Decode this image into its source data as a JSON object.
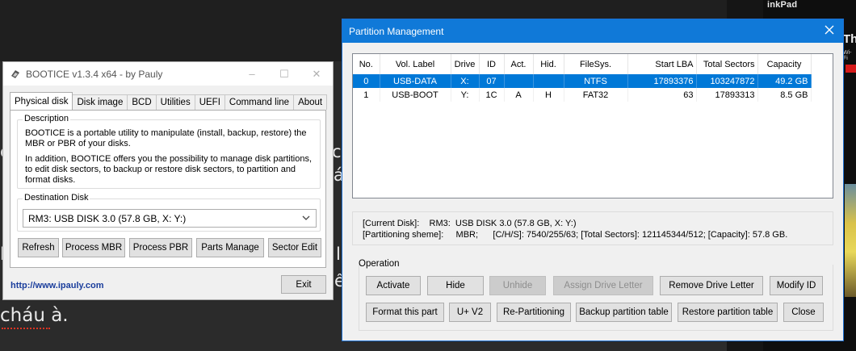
{
  "background": {
    "corner_brand": "inkPad",
    "side_brand": "Thin",
    "side_wifi": "Wi-Fi",
    "snippets": [
      "cháu à.",
      "c",
      "á",
      "l",
      "ế",
      "c",
      "l"
    ]
  },
  "bootice": {
    "title": "BOOTICE v1.3.4 x64 - by Pauly",
    "tabs": [
      "Physical disk",
      "Disk image",
      "BCD",
      "Utilities",
      "UEFI",
      "Command line",
      "About"
    ],
    "description_legend": "Description",
    "description_p1": "BOOTICE is a portable utility to manipulate (install, backup, restore) the MBR or PBR of your disks.",
    "description_p2": "In addition, BOOTICE offers you the possibility to manage disk partitions, to edit disk sectors, to backup or restore disk sectors, to partition and format disks.",
    "destination_legend": "Destination Disk",
    "destination_value": "RM3:  USB DISK 3.0 (57.8 GB, X: Y:)",
    "buttons": {
      "refresh": "Refresh",
      "process_mbr": "Process MBR",
      "process_pbr": "Process PBR",
      "parts_manage": "Parts Manage",
      "sector_edit": "Sector Edit",
      "exit": "Exit"
    },
    "link": "http://www.ipauly.com"
  },
  "partition_manager": {
    "title": "Partition Management",
    "columns": [
      "No.",
      "Vol. Label",
      "Drive",
      "ID",
      "Act.",
      "Hid.",
      "FileSys.",
      "Start LBA",
      "Total Sectors",
      "Capacity"
    ],
    "rows": [
      {
        "no": "0",
        "label": "USB-DATA",
        "drive": "X:",
        "id": "07",
        "act": "",
        "hid": "",
        "fs": "NTFS",
        "start": "17893376",
        "total": "103247872",
        "capacity": "49.2 GB",
        "selected": true
      },
      {
        "no": "1",
        "label": "USB-BOOT",
        "drive": "Y:",
        "id": "1C",
        "act": "A",
        "hid": "H",
        "fs": "FAT32",
        "start": "63",
        "total": "17893313",
        "capacity": "8.5 GB",
        "selected": false
      }
    ],
    "info_line1": "[Current Disk]:    RM3:  USB DISK 3.0 (57.8 GB, X: Y:)",
    "info_line2": "[Partitioning sheme]:     MBR;      [C/H/S]: 7540/255/63; [Total Sectors]: 121145344/512; [Capacity]: 57.8 GB.",
    "operation_label": "Operation",
    "buttons": {
      "activate": "Activate",
      "hide": "Hide",
      "unhide": "Unhide",
      "assign_drive_letter": "Assign Drive Letter",
      "remove_drive_letter": "Remove Drive Letter",
      "modify_id": "Modify ID",
      "format": "Format this part",
      "u_v2": "U+ V2",
      "repartitioning": "Re-Partitioning",
      "backup_table": "Backup partition table",
      "restore_table": "Restore partition table",
      "close": "Close"
    },
    "disabled_buttons": [
      "unhide",
      "assign_drive_letter"
    ],
    "colors": {
      "selection": "#0078d7",
      "titlebar": "#1079d8"
    }
  }
}
